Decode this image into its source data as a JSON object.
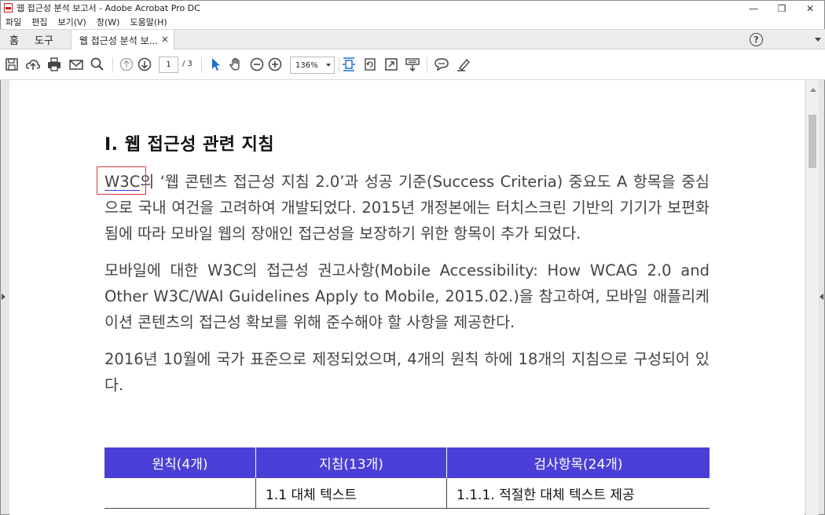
{
  "window": {
    "title": "웹 접근성 분석 보고서 - Adobe Acrobat Pro DC",
    "controls": {
      "minimize": "—",
      "restore": "❐",
      "close": "✕"
    }
  },
  "menu": [
    "파일",
    "편집",
    "보기(V)",
    "창(W)",
    "도움말(H)"
  ],
  "tabs": {
    "home": "홈",
    "tools": "도구",
    "document": "웹 접근성 분석 보...",
    "close": "×",
    "help": "?"
  },
  "toolbar": {
    "page_current": "1",
    "page_total": "/ 3",
    "zoom": "136%",
    "icons": [
      "save-icon",
      "upload-icon",
      "print-icon",
      "email-icon",
      "search-icon",
      "prev-page-icon",
      "next-page-icon",
      "select-cursor-icon",
      "hand-icon",
      "zoom-out-icon",
      "zoom-in-icon",
      "fit-page-icon",
      "rotate-icon",
      "fullscreen-icon",
      "scroll-mode-icon",
      "comment-icon",
      "highlight-pen-icon"
    ],
    "accent_color": "#1c6fd1"
  },
  "document": {
    "heading": "I. 웹 접근성 관련 지침",
    "p1_highlight": "W3C",
    "p1_rest": "의 ‘웹 콘텐츠 접근성 지침 2.0’과 성공 기준(Success Criteria) 중요도 A 항목을 중심으로 국내 여건을 고려하여 개발되었다. 2015년 개정본에는 터치스크린 기반의 기기가 보편화됨에 따라 모바일 웹의 장애인 접근성을 보장하기 위한 항목이 추가 되었다.",
    "p2": "모바일에 대한 W3C의 접근성 권고사항(Mobile Accessibility: How WCAG 2.0 and Other W3C/WAI Guidelines Apply to Mobile, 2015.02.)을 참고하여, 모바일 애플리케이션 콘텐츠의 접근성 확보를 위해 준수해야 할 사항을 제공한다.",
    "p3": "2016년 10월에 국가 표준으로 제정되었으며, 4개의 원칙 하에 18개의 지침으로 구성되어 있다.",
    "table": {
      "header_color": "#4a3fd6",
      "headers": [
        "원칙(4개)",
        "지침(13개)",
        "검사항목(24개)"
      ],
      "rows": [
        [
          "",
          "1.1 대체 텍스트",
          "1.1.1.  적절한 대체 텍스트 제공"
        ]
      ]
    }
  }
}
